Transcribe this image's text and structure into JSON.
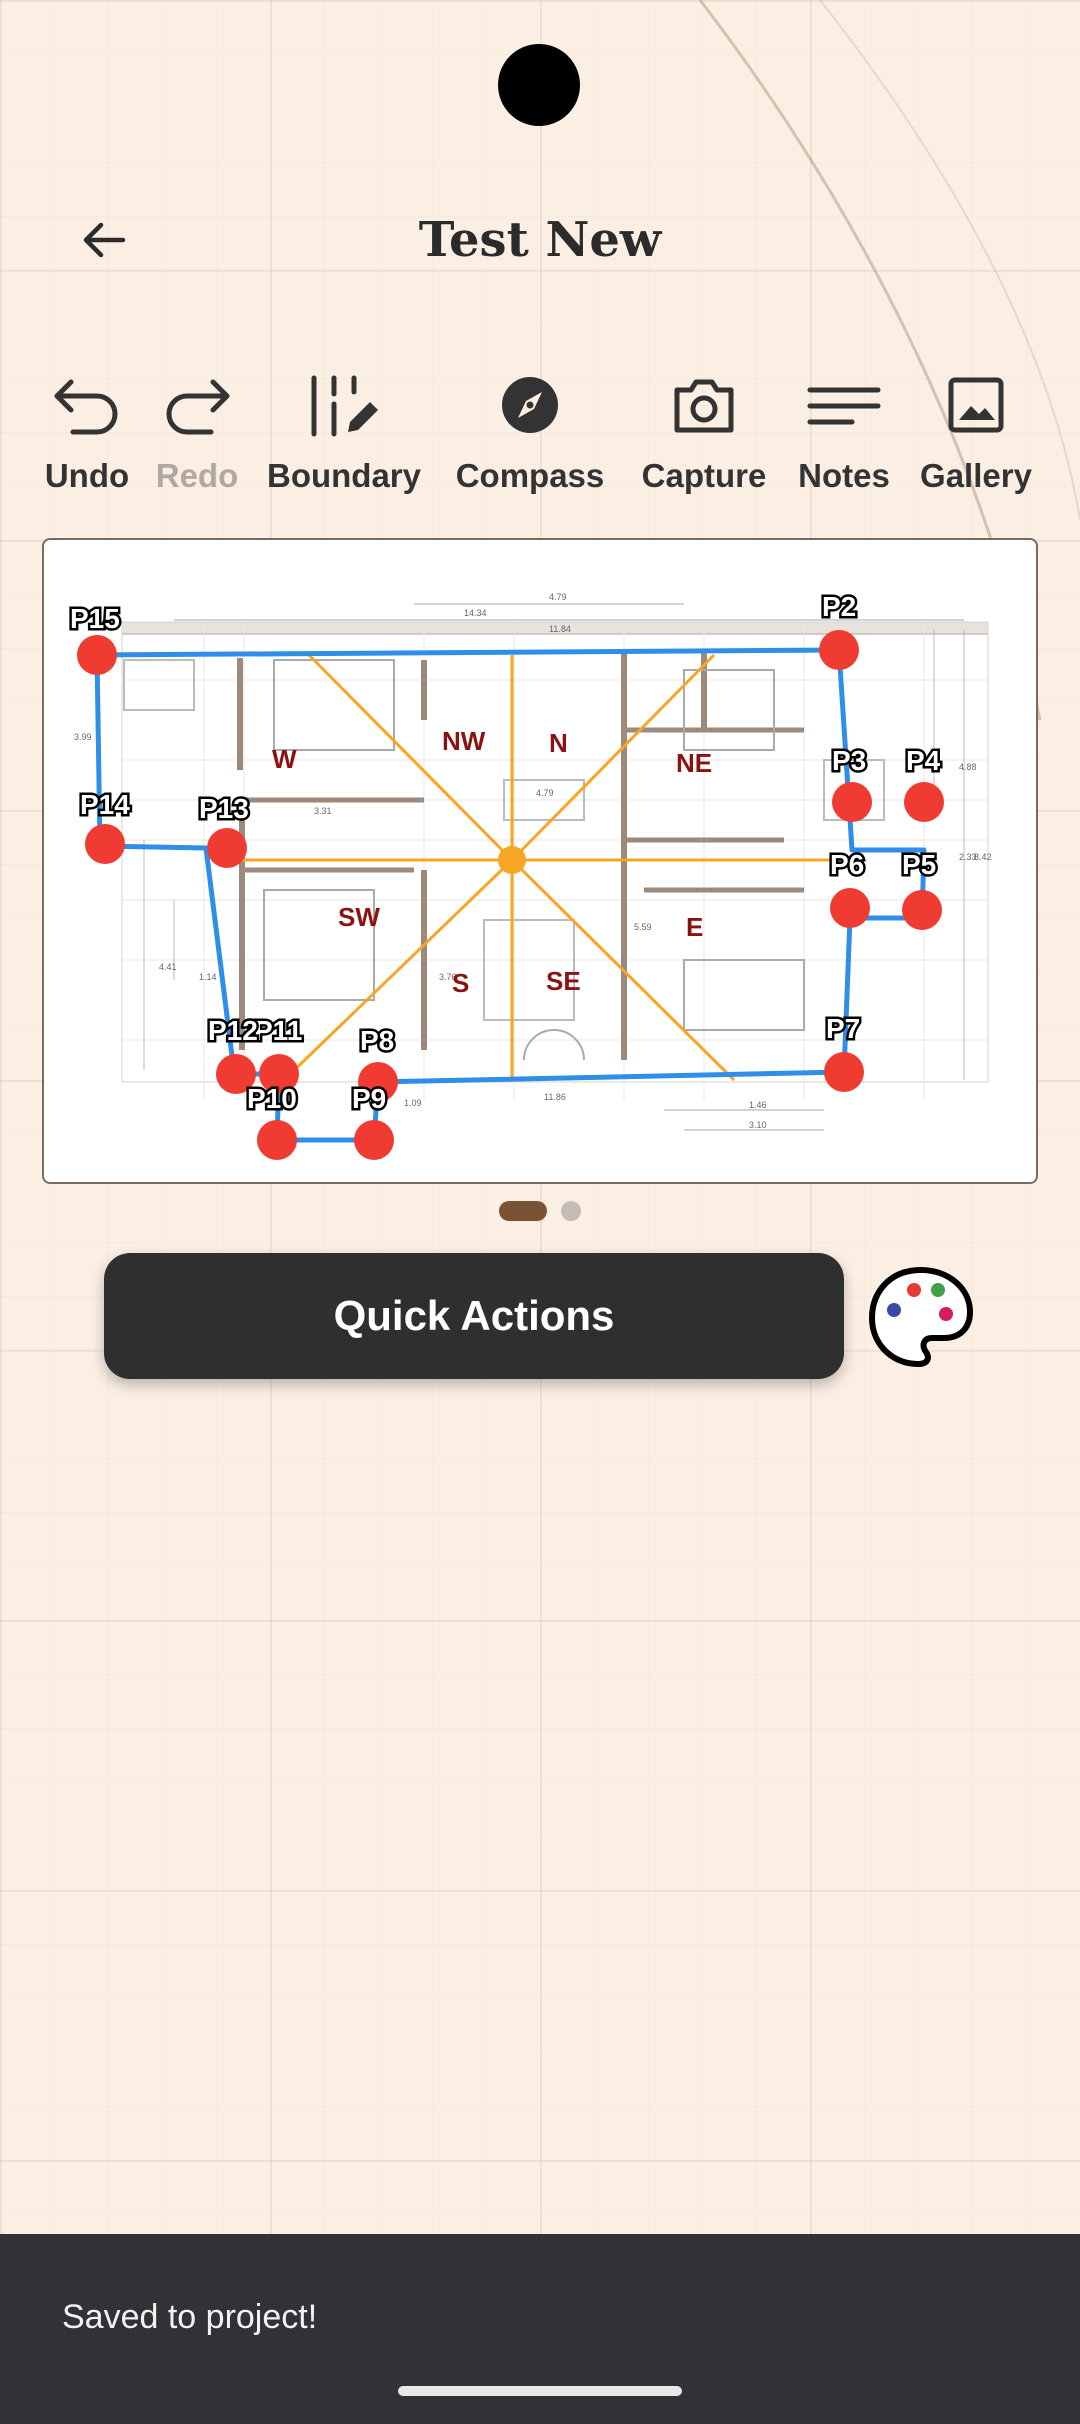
{
  "header": {
    "title": "Test New",
    "back_icon": "arrow-left-icon"
  },
  "toolbar": {
    "items": [
      {
        "label": "Undo",
        "icon": "undo-icon",
        "enabled": true
      },
      {
        "label": "Redo",
        "icon": "redo-icon",
        "enabled": false
      },
      {
        "label": "Boundary",
        "icon": "boundary-pencil-icon",
        "enabled": true
      },
      {
        "label": "Compass",
        "icon": "compass-icon",
        "enabled": true
      },
      {
        "label": "Capture",
        "icon": "camera-icon",
        "enabled": true
      },
      {
        "label": "Notes",
        "icon": "notes-lines-icon",
        "enabled": true
      },
      {
        "label": "Gallery",
        "icon": "image-icon",
        "enabled": true
      }
    ]
  },
  "floorplan": {
    "points": [
      "P2",
      "P3",
      "P4",
      "P5",
      "P6",
      "P7",
      "P8",
      "P9",
      "P10",
      "P11",
      "P12",
      "P13",
      "P14",
      "P15"
    ],
    "directions": [
      "N",
      "NE",
      "E",
      "SE",
      "S",
      "SW",
      "W",
      "NW"
    ],
    "dimensions": [
      "4.79",
      "14.34",
      "11.84",
      "3.99",
      "3.31",
      "4.79",
      "4.88",
      "2.33",
      "8.42",
      "4.41",
      "1.14",
      "3.76",
      "5.59",
      "1.09",
      "11.86",
      "1.46",
      "3.10"
    ],
    "colors": {
      "boundary": "#2e8ee8",
      "point": "#f03b32",
      "compass_lines": "#f6a623",
      "direction_text": "#8b1212"
    }
  },
  "pager": {
    "count": 2,
    "active": 0
  },
  "quick_actions": {
    "label": "Quick Actions"
  },
  "palette": {
    "icon": "palette-icon",
    "dot_colors": [
      "#e53935",
      "#43a047",
      "#3949ab",
      "#d81b60"
    ]
  },
  "snackbar": {
    "message": "Saved to project!"
  }
}
